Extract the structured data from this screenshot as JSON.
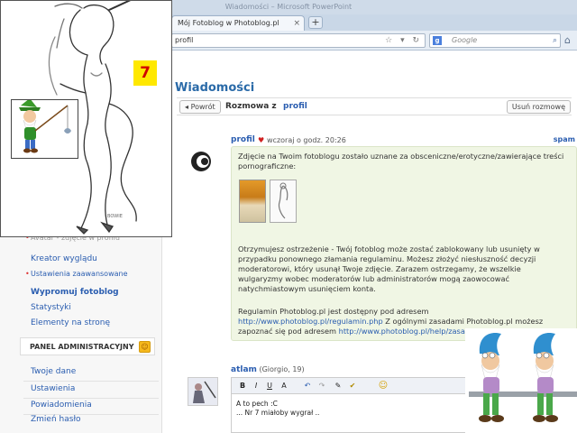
{
  "browser": {
    "window_title": "Wiadomości – Microsoft PowerPoint",
    "tab_title": "Mój Fotoblog w Photoblog.pl",
    "tab_close": "×",
    "new_tab": "+",
    "url": "profil",
    "search_engine_badge": "g",
    "search_placeholder": "Google",
    "icons": [
      "star-icon",
      "refresh-icon",
      "google-icon",
      "search-icon",
      "home-icon"
    ]
  },
  "sidebar": {
    "partial_item": "Avatar - zdjęcie w profilu",
    "links": [
      {
        "label": "Kreator wyglądu"
      },
      {
        "label": "Ustawienia zaawansowane"
      },
      {
        "label": "Wypromuj fotoblog"
      },
      {
        "label": "Statystyki"
      },
      {
        "label": "Elementy na stronę"
      }
    ],
    "admin_panel_title": "PANEL ADMINISTRACYJNY",
    "admin_links": [
      {
        "label": "Twoje dane"
      },
      {
        "label": "Ustawienia"
      },
      {
        "label": "Powiadomienia"
      },
      {
        "label": "Zmień hasło"
      }
    ]
  },
  "main": {
    "heading": "Wiadomości",
    "back_button": "Powrót",
    "conversation_label": "Rozmowa z",
    "conversation_user": "profil",
    "delete_button": "Usuń rozmowę",
    "message": {
      "user": "profil",
      "time": "wczoraj o godz. 20:26",
      "spam": "spam",
      "p1": "Zdjęcie na Twoim fotoblogu zostało uznane za obsceniczne/erotyczne/zawierające treści pornograficzne:",
      "p2": "Otrzymujesz ostrzeżenie - Twój fotoblog może zostać zablokowany lub usunięty w przypadku ponownego złamania regulaminu. Możesz złożyć niesłuszność decyzji moderatorowi, który usunął Twoje zdjęcie. Zarazem ostrzegamy, że wszelkie wulgaryzmy wobec moderatorów lub administratorów mogą zaowocować natychmiastowym usunięciem konta.",
      "p3_a": "Regulamin Photoblog.pl jest dostępny pod adresem ",
      "p3_link1": "http://www.photoblog.pl/regulamin.php",
      "p3_b": " Z ogólnymi zasadami Photoblog.pl możesz zapoznać się pod adresem ",
      "p3_link2": "http://www.photoblog.pl/help/zasady.html"
    },
    "reply": {
      "user": "atlam",
      "sub": "(Giorgio, 19)",
      "line1": "A to pech :C",
      "line2": "... Nr 7 miałoby wygrał ..",
      "toolbar": [
        "B",
        "I",
        "U",
        "A",
        "↶",
        "↷",
        "✎",
        "✔",
        "☺"
      ]
    }
  },
  "overlay": {
    "badge_number": "7"
  }
}
